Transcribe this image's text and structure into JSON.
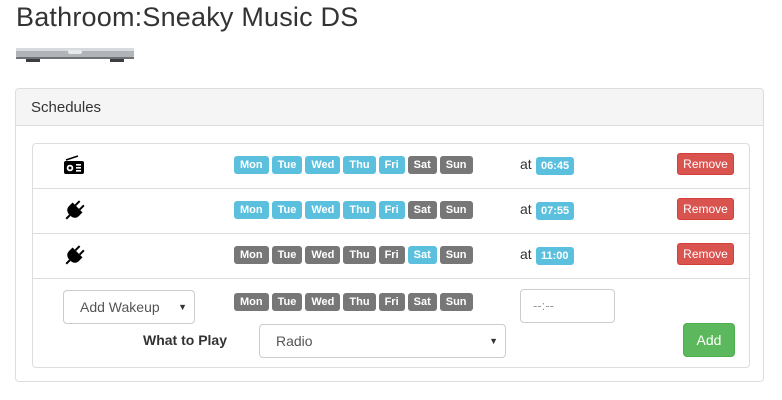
{
  "page": {
    "title": "Bathroom:Sneaky Music DS"
  },
  "panel": {
    "heading": "Schedules"
  },
  "schedules": [
    {
      "icon": "radio-icon",
      "days": [
        {
          "label": "Mon",
          "active": true
        },
        {
          "label": "Tue",
          "active": true
        },
        {
          "label": "Wed",
          "active": true
        },
        {
          "label": "Thu",
          "active": true
        },
        {
          "label": "Fri",
          "active": true
        },
        {
          "label": "Sat",
          "active": false
        },
        {
          "label": "Sun",
          "active": false
        }
      ],
      "at": "at",
      "time": "06:45",
      "remove_label": "Remove"
    },
    {
      "icon": "plug-icon",
      "days": [
        {
          "label": "Mon",
          "active": true
        },
        {
          "label": "Tue",
          "active": true
        },
        {
          "label": "Wed",
          "active": true
        },
        {
          "label": "Thu",
          "active": true
        },
        {
          "label": "Fri",
          "active": true
        },
        {
          "label": "Sat",
          "active": false
        },
        {
          "label": "Sun",
          "active": false
        }
      ],
      "at": "at",
      "time": "07:55",
      "remove_label": "Remove"
    },
    {
      "icon": "plug-icon",
      "days": [
        {
          "label": "Mon",
          "active": false
        },
        {
          "label": "Tue",
          "active": false
        },
        {
          "label": "Wed",
          "active": false
        },
        {
          "label": "Thu",
          "active": false
        },
        {
          "label": "Fri",
          "active": false
        },
        {
          "label": "Sat",
          "active": true
        },
        {
          "label": "Sun",
          "active": false
        }
      ],
      "at": "at",
      "time": "11:00",
      "remove_label": "Remove"
    }
  ],
  "new_schedule": {
    "type_select": "Add Wakeup",
    "days": [
      "Mon",
      "Tue",
      "Wed",
      "Thu",
      "Fri",
      "Sat",
      "Sun"
    ],
    "time_placeholder": "--:--",
    "what_to_play_label": "What to Play",
    "play_select": "Radio",
    "add_label": "Add"
  },
  "colors": {
    "day_active": "#5bc0de",
    "day_inactive": "#777777",
    "remove": "#d9534f",
    "add": "#5cb85c"
  }
}
